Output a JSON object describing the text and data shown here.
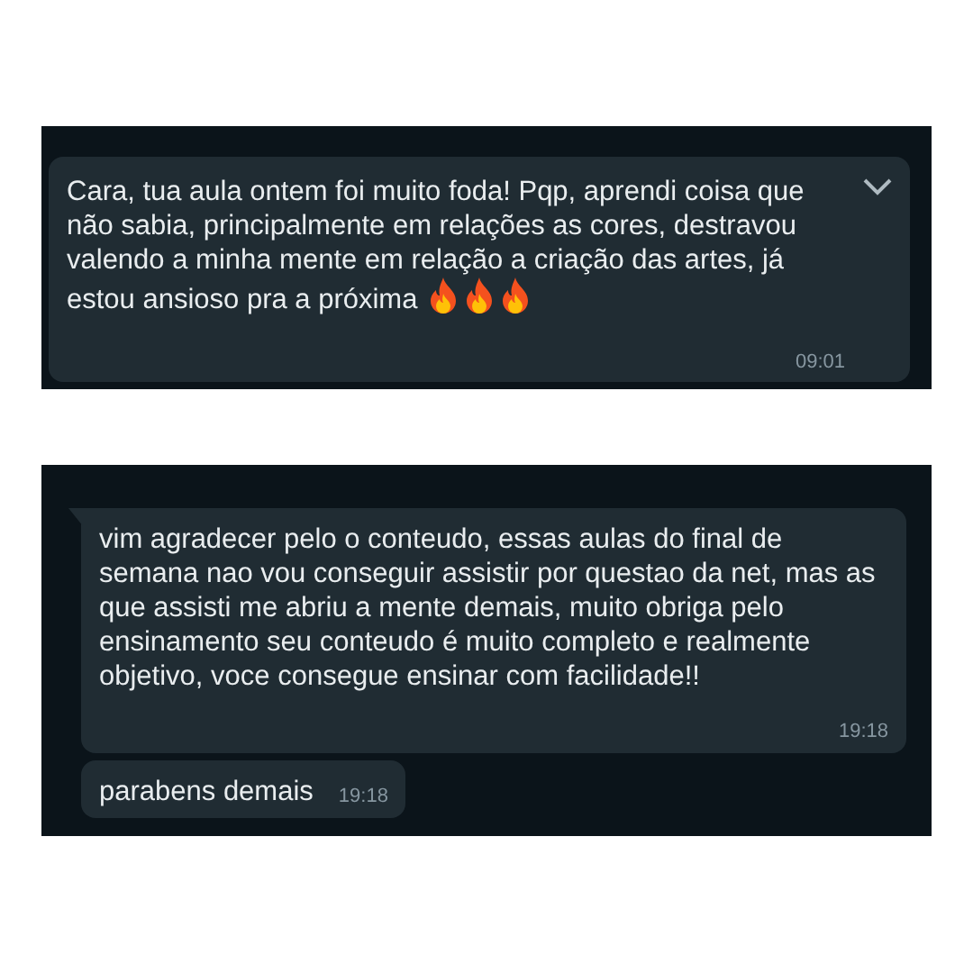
{
  "screenshots": [
    {
      "messages": [
        {
          "text": "Cara, tua aula ontem foi muito foda! Pqp, aprendi coisa que não sabia, principalmente em relações as cores, destravou valendo a minha mente em relação a criação das artes, já estou ansioso pra a próxima",
          "time": "09:01",
          "tail": false,
          "menu": true,
          "fire": true
        }
      ]
    },
    {
      "messages": [
        {
          "text": "vim agradecer pelo o conteudo, essas aulas do final de semana nao vou conseguir assistir por questao da net, mas as que assisti me abriu a mente demais, muito obriga pelo ensinamento seu conteudo é muito completo e realmente objetivo, voce consegue ensinar com facilidade!!",
          "time": "19:18",
          "tail": true
        },
        {
          "text": "parabens demais",
          "time": "19:18",
          "tail": false
        }
      ]
    }
  ]
}
